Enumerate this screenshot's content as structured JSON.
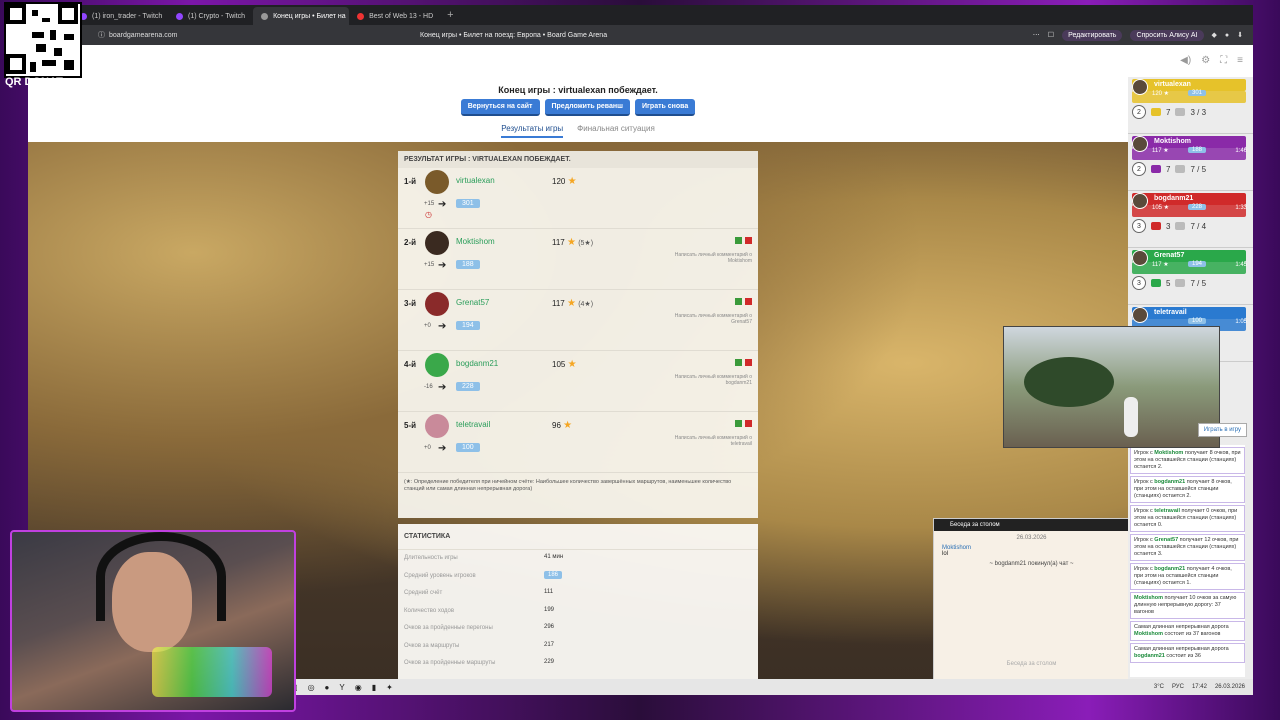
{
  "qr": {
    "label": "QR DONAT"
  },
  "tabs": [
    {
      "label": "(1) iron_trader - Twitch"
    },
    {
      "label": "(1) Crypto - Twitch"
    },
    {
      "label": "Конец игры • Билет на"
    },
    {
      "label": "Best of Web 13 - HD"
    }
  ],
  "address": {
    "url": "boardgamearena.com",
    "page_title": "Конец игры • Билет на поезд: Европа • Board Game Arena",
    "edit_label": "Редактировать",
    "alice_label": "Спросить Алису AI"
  },
  "game_header": {
    "title": "Конец игры : virtualexan побеждает.",
    "buttons": [
      "Вернуться на сайт",
      "Предложить реванш",
      "Играть снова"
    ],
    "tabs": [
      "Результаты игры",
      "Финальная ситуация"
    ]
  },
  "results": {
    "header": "РЕЗУЛЬТАТ ИГРЫ : VIRTUALEXAN ПОБЕЖДАЕТ.",
    "players": [
      {
        "rank": "1-й",
        "name": "virtualexan",
        "score": "120",
        "tie": "",
        "delta": "+15",
        "elo": "301",
        "color": "#2a9d5a",
        "msg": ""
      },
      {
        "rank": "2-й",
        "name": "Moktishom",
        "score": "117",
        "tie": "(5★)",
        "delta": "+15",
        "elo": "188",
        "color": "#2a9d5a",
        "msg": "Написать личный комментарий о Moktishom"
      },
      {
        "rank": "3-й",
        "name": "Grenat57",
        "score": "117",
        "tie": "(4★)",
        "delta": "+0",
        "elo": "194",
        "color": "#2a9d5a",
        "msg": "Написать личный комментарий о Grenat57"
      },
      {
        "rank": "4-й",
        "name": "bogdanm21",
        "score": "105",
        "tie": "",
        "delta": "-16",
        "elo": "228",
        "color": "#2a9d5a",
        "msg": "Написать личный комментарий о bogdanm21"
      },
      {
        "rank": "5-й",
        "name": "teletravail",
        "score": "96",
        "tie": "",
        "delta": "+0",
        "elo": "100",
        "color": "#2a9d5a",
        "msg": "Написать личный комментарий о teletravail"
      }
    ],
    "note": "(★: Определение победителя при ничейном счёте: Наибольшее количество завершённых маршрутов, наименьшее количество станций или самая длинная непрерывная дорога)"
  },
  "stats": {
    "header": "СТАТИСТИКА",
    "rows": [
      {
        "k": "Длительность игры",
        "v": "41 мин"
      },
      {
        "k": "Средний уровень игроков",
        "v": "186"
      },
      {
        "k": "Средний счёт",
        "v": "111"
      },
      {
        "k": "Количество ходов",
        "v": "199"
      },
      {
        "k": "Очков за пройденные перегоны",
        "v": "296"
      },
      {
        "k": "Очков за маршруты",
        "v": "217"
      },
      {
        "k": "Очков за пройденные маршруты",
        "v": "229"
      }
    ]
  },
  "sidebar": {
    "players": [
      {
        "name": "virtualexan",
        "pts": "120 ★",
        "elo": "301",
        "time": "",
        "color": "#e6c22a",
        "a": "2",
        "b": "7",
        "c": "3 / 3"
      },
      {
        "name": "Moktishom",
        "pts": "117 ★",
        "elo": "188",
        "time": "1:46",
        "color": "#8a2aa8",
        "a": "2",
        "b": "7",
        "c": "7 / 5"
      },
      {
        "name": "bogdanm21",
        "pts": "105 ★",
        "elo": "228",
        "time": "1:33",
        "color": "#d02a2a",
        "a": "3",
        "b": "3",
        "c": "7 / 4"
      },
      {
        "name": "Grenat57",
        "pts": "117 ★",
        "elo": "194",
        "time": "1:45",
        "color": "#2aa84a",
        "a": "3",
        "b": "5",
        "c": "7 / 5"
      },
      {
        "name": "teletravail",
        "pts": "",
        "elo": "100",
        "time": "1:05",
        "color": "#2a7ad0",
        "a": "",
        "b": "3",
        "c": "7 / 6"
      }
    ],
    "log": [
      {
        "pre": "Игрок с ",
        "who": "Moktishom",
        "post": " получает 8 очков, при этом на оставшейся станции (станциях) остается 2."
      },
      {
        "pre": "Игрок с ",
        "who": "bogdanm21",
        "post": " получает 8 очков, при этом на оставшейся станции (станциях) остается 2."
      },
      {
        "pre": "Игрок с ",
        "who": "teletravail",
        "post": " получает 0 очков, при этом на оставшейся станции (станциях) остается 0."
      },
      {
        "pre": "Игрок с ",
        "who": "Grenat57",
        "post": " получает 12 очков, при этом на оставшейся станции (станциях) остается 3."
      },
      {
        "pre": "Игрок с ",
        "who": "bogdanm21",
        "post": " получает 4 очков, при этом на оставшейся станции (станциях) остается 1."
      },
      {
        "pre": "",
        "who": "Moktishom",
        "post": " получает 10 очков за самую длинную непрерывную дорогу: 37 вагонов"
      },
      {
        "pre": "Самая длинная непрерывная дорога ",
        "who": "Moktishom",
        "post": " состоит из 37 вагонов"
      },
      {
        "pre": "Самая длинная непрерывная дорога ",
        "who": "bogdanm21",
        "post": " состоит из 36"
      }
    ],
    "play_btn": "Играть в игру"
  },
  "chat": {
    "title": "Беседа за столом",
    "date": "26.03.2026",
    "who": "Moktishom",
    "msg": "lol",
    "sys": "~ bogdanm21 покинул(а) чат ~",
    "input": "Беседа за столом"
  },
  "tray": {
    "weather": "3°C",
    "lang": "РУС",
    "time": "17:42",
    "date": "26.03.2026"
  },
  "colors": {
    "accent": "#3a7bd5",
    "win": "#2a9d5a"
  }
}
